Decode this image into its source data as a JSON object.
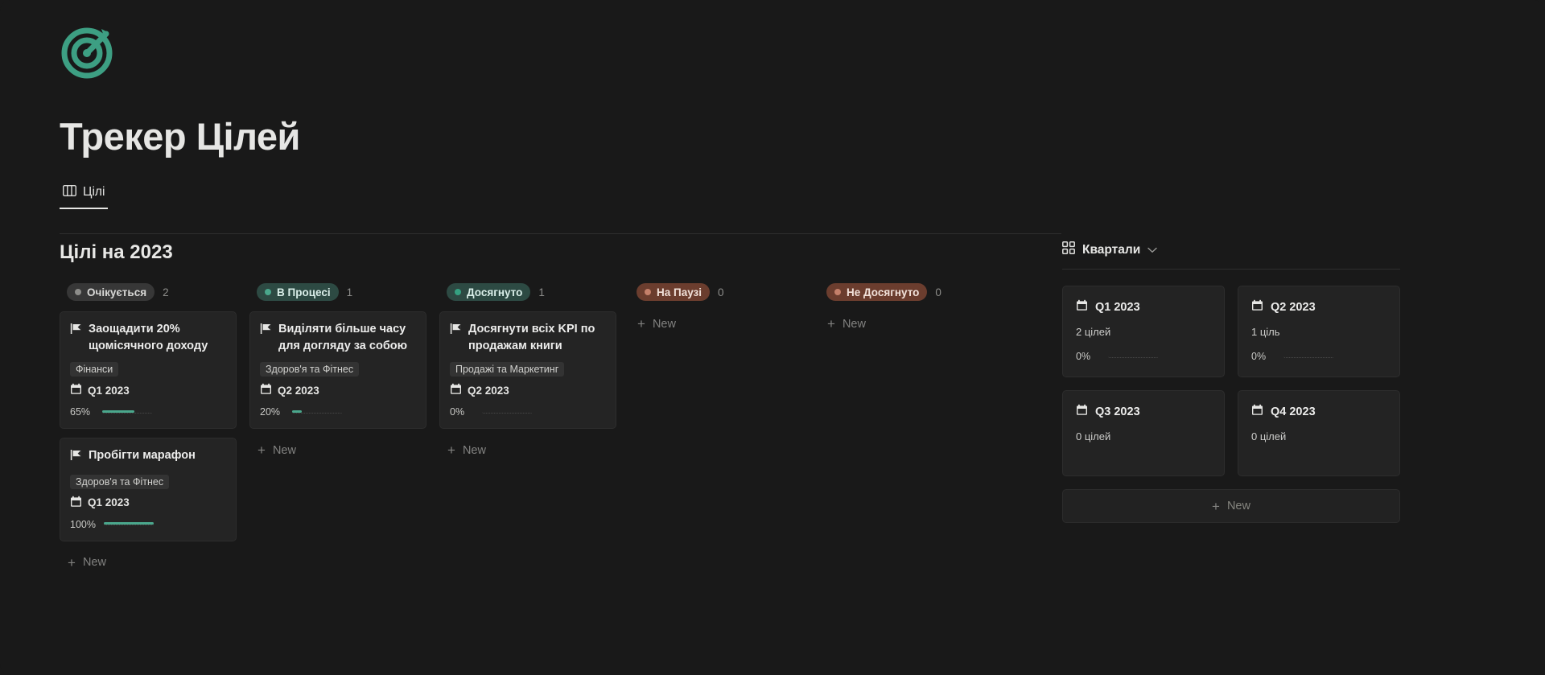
{
  "app": {
    "title": "Трекер Цілей",
    "logo_icon": "target-icon"
  },
  "tabs": [
    {
      "label": "Цілі",
      "icon": "board-icon",
      "active": true
    }
  ],
  "board": {
    "heading": "Цілі на 2023",
    "new_label": "New",
    "columns": [
      {
        "status": "Очікується",
        "status_color": "#8d8d8a",
        "pill_style": "gray",
        "count": "2",
        "cards": [
          {
            "title": "Заощадити 20% щомісячного доходу",
            "icon": "flag-icon",
            "tag": "Фінанси",
            "quarter": "Q1 2023",
            "quarter_icon": "calendar-icon",
            "progress_label": "65%",
            "progress_value": 65
          },
          {
            "title": "Пробігти марафон",
            "icon": "flag-icon",
            "tag": "Здоров'я та Фітнес",
            "quarter": "Q1 2023",
            "quarter_icon": "calendar-icon",
            "progress_label": "100%",
            "progress_value": 100
          }
        ]
      },
      {
        "status": "В Процесі",
        "status_color": "#4aa78c",
        "pill_style": "green",
        "count": "1",
        "cards": [
          {
            "title": "Виділяти більше часу для догляду за собою",
            "icon": "flag-icon",
            "tag": "Здоров'я та Фітнес",
            "quarter": "Q2 2023",
            "quarter_icon": "calendar-icon",
            "progress_label": "20%",
            "progress_value": 20
          }
        ]
      },
      {
        "status": "Досягнуто",
        "status_color": "#35a181",
        "pill_style": "green",
        "count": "1",
        "cards": [
          {
            "title": "Досягнути всіх KPI по продажам книги",
            "icon": "flag-icon",
            "tag": "Продажі та Маркетинг",
            "quarter": "Q2 2023",
            "quarter_icon": "calendar-icon",
            "progress_label": "0%",
            "progress_value": 0
          }
        ]
      },
      {
        "status": "На Паузі",
        "status_color": "#c4806a",
        "pill_style": "brown",
        "count": "0",
        "cards": []
      },
      {
        "status": "Не Досягнуто",
        "status_color": "#c4806a",
        "pill_style": "brown",
        "count": "0",
        "cards": []
      }
    ]
  },
  "side_panel": {
    "title": "Квартали",
    "icon": "grid-icon",
    "chevron": "chevron-down-icon",
    "new_label": "New",
    "quarters": [
      {
        "name": "Q1 2023",
        "goals": "2 цілей",
        "progress_label": "0%",
        "progress_value": 0,
        "has_progress": true
      },
      {
        "name": "Q2 2023",
        "goals": "1 ціль",
        "progress_label": "0%",
        "progress_value": 0,
        "has_progress": true
      },
      {
        "name": "Q3 2023",
        "goals": "0 цілей",
        "progress_label": "",
        "progress_value": 0,
        "has_progress": false
      },
      {
        "name": "Q4 2023",
        "goals": "0 цілей",
        "progress_label": "",
        "progress_value": 0,
        "has_progress": false
      }
    ]
  },
  "theme": {
    "background": "#191919",
    "accent": "#4aa78c",
    "card_bg": "#242424"
  }
}
